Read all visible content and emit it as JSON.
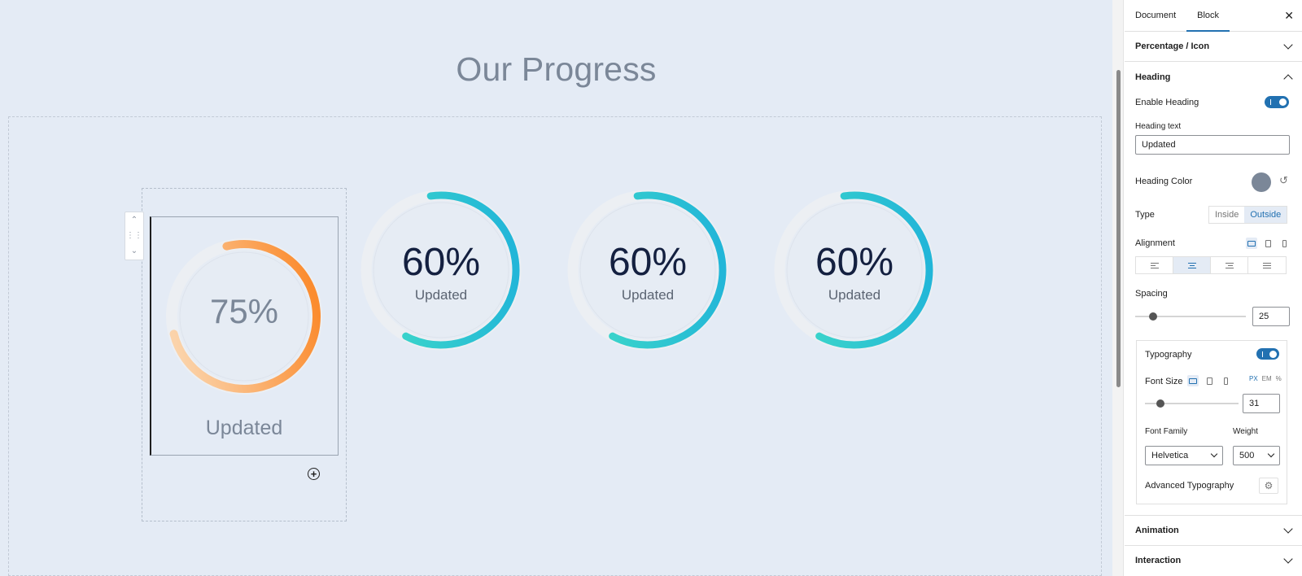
{
  "canvas": {
    "title": "Our Progress",
    "block_toolbar": {
      "up": "^",
      "drag": "⋮⋮",
      "down": "v"
    },
    "add_block": "+"
  },
  "counters": [
    {
      "percent": 75,
      "label": "75%",
      "heading": "Updated",
      "style": "outside",
      "colors": [
        "#fbd3aa",
        "#fb8c2f"
      ],
      "track": "#eceff3"
    },
    {
      "percent": 60,
      "label": "60%",
      "heading": "Updated",
      "style": "inside",
      "colors": [
        "#3ed9c8",
        "#22b6d8"
      ],
      "track": "#eceff3"
    },
    {
      "percent": 60,
      "label": "60%",
      "heading": "Updated",
      "style": "inside",
      "colors": [
        "#3ed9c8",
        "#22b6d8"
      ],
      "track": "#eceff3"
    },
    {
      "percent": 60,
      "label": "60%",
      "heading": "Updated",
      "style": "inside",
      "colors": [
        "#3ed9c8",
        "#22b6d8"
      ],
      "track": "#eceff3"
    }
  ],
  "sidebar": {
    "tabs": [
      "Document",
      "Block"
    ],
    "active_tab": "Block",
    "close_icon": "close-icon",
    "panels": {
      "percentage_icon": "Percentage / Icon",
      "heading": "Heading",
      "animation": "Animation",
      "interaction": "Interaction"
    },
    "heading_settings": {
      "enable_heading_label": "Enable Heading",
      "enable_heading": true,
      "heading_text_label": "Heading text",
      "heading_text_value": "Updated",
      "heading_color_label": "Heading Color",
      "heading_color": "#7b8798",
      "type_label": "Type",
      "type_options": [
        "Inside",
        "Outside"
      ],
      "type_selected": "Outside",
      "alignment_label": "Alignment",
      "alignment_selected": "center",
      "spacing_label": "Spacing",
      "spacing_value": "25",
      "typography_label": "Typography",
      "typography_enabled": true,
      "font_size_label": "Font Size",
      "font_size_units": [
        "PX",
        "EM",
        "%"
      ],
      "font_size_unit_selected": "PX",
      "font_size_value": "31",
      "font_family_label": "Font Family",
      "font_family_value": "Helvetica",
      "weight_label": "Weight",
      "weight_value": "500",
      "advanced_typography_label": "Advanced Typography"
    },
    "accent_color": "#2271b1"
  }
}
